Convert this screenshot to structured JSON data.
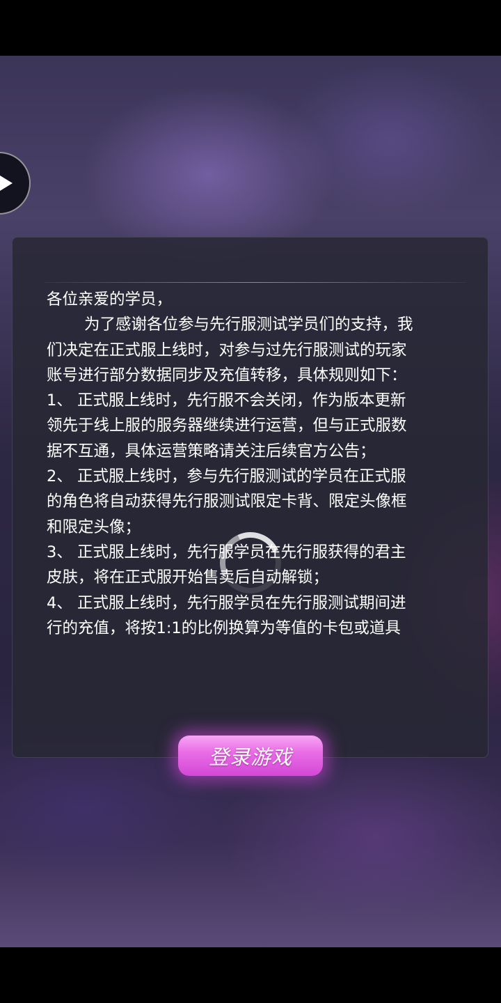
{
  "notice": {
    "lines": [
      "各位亲爱的学员，",
      "为了感谢各位参与先行服测试学员们的支持，我",
      "们决定在正式服上线时，对参与过先行服测试的玩家",
      "账号进行部分数据同步及充值转移，具体规则如下：",
      "1、 正式服上线时，先行服不会关闭，作为版本更新",
      "领先于线上服的服务器继续进行运营，但与正式服数",
      "据不互通，具体运营策略请关注后续官方公告；",
      "2、 正式服上线时，参与先行服测试的学员在正式服",
      "的角色将自动获得先行服测试限定卡背、限定头像框",
      "和限定头像；",
      "3、 正式服上线时，先行服学员在先行服获得的君主",
      "皮肤，将在正式服开始售卖后自动解锁；",
      "4、 正式服上线时，先行服学员在先行服测试期间进",
      "行的充值，将按1:1的比例换算为等值的卡包或道具"
    ]
  },
  "login_button": {
    "label": "登录游戏"
  },
  "icons": {
    "play": "play-icon",
    "spinner": "loading-spinner-icon"
  },
  "colors": {
    "login_gradient_top": "#f7a6f5",
    "login_gradient_bottom": "#d348d6",
    "panel_bg": "#28283a"
  }
}
